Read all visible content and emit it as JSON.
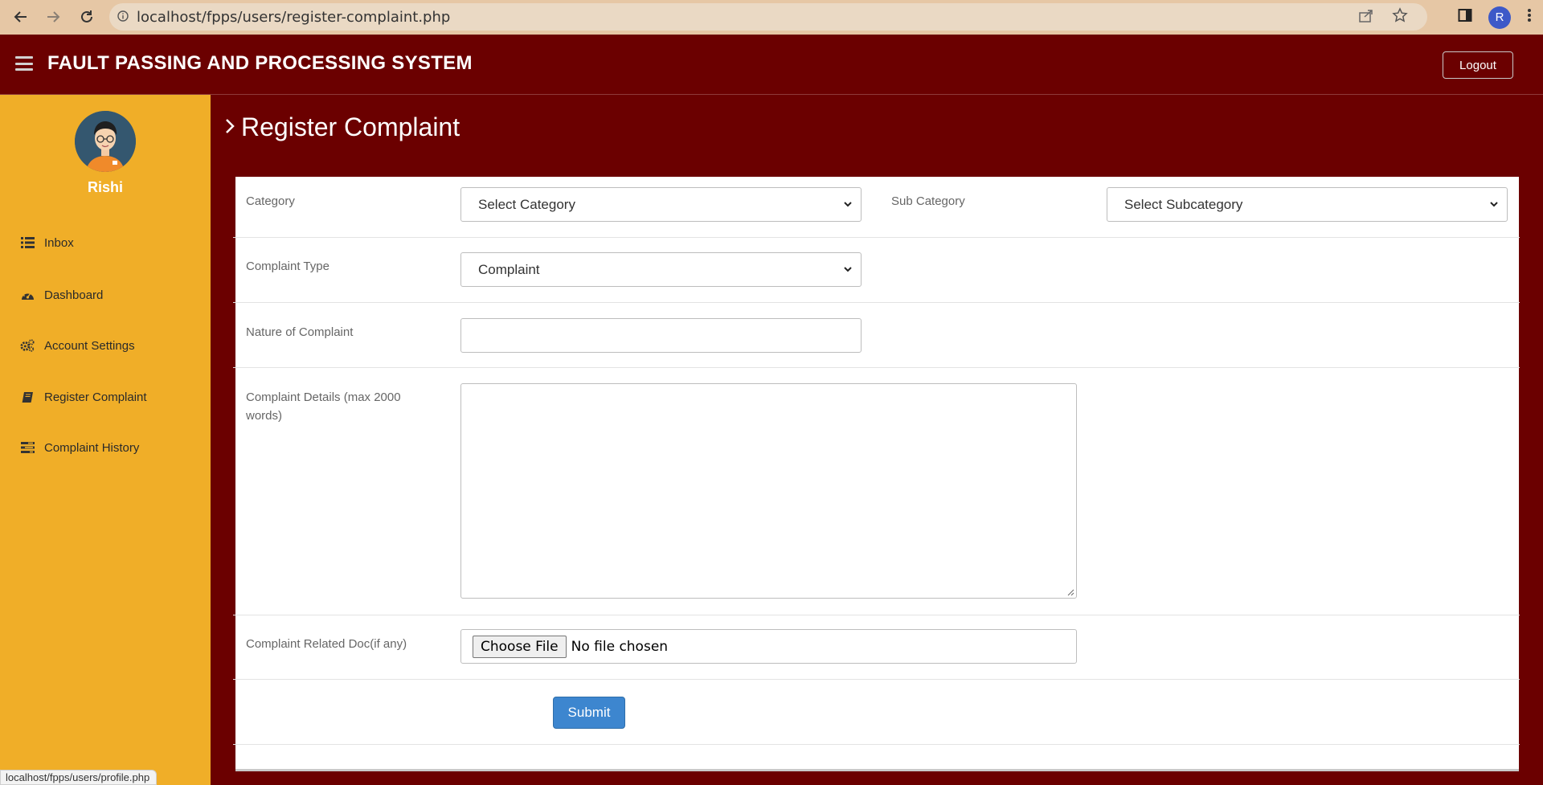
{
  "browser": {
    "url": "localhost/fpps/users/register-complaint.php",
    "profile_initial": "R",
    "status_url": "localhost/fpps/users/profile.php"
  },
  "header": {
    "title": "FAULT PASSING AND PROCESSING SYSTEM",
    "logout_label": "Logout"
  },
  "sidebar": {
    "user_name": "Rishi",
    "items": [
      {
        "label": "Inbox",
        "icon": "list-icon"
      },
      {
        "label": "Dashboard",
        "icon": "dashboard-icon"
      },
      {
        "label": "Account Settings",
        "icon": "gears-icon"
      },
      {
        "label": "Register Complaint",
        "icon": "book-icon"
      },
      {
        "label": "Complaint History",
        "icon": "tasks-icon"
      }
    ]
  },
  "page": {
    "title": "Register Complaint"
  },
  "form": {
    "category_label": "Category",
    "category_value": "Select Category",
    "subcategory_label": "Sub Category",
    "subcategory_value": "Select Subcategory",
    "complaint_type_label": "Complaint Type",
    "complaint_type_value": "Complaint",
    "nature_label": "Nature of Complaint",
    "nature_value": "",
    "details_label": "Complaint Details (max 2000 words)",
    "details_value": "",
    "doc_label": "Complaint Related Doc(if any)",
    "file_button": "Choose File",
    "file_status": "No file chosen",
    "submit_label": "Submit"
  },
  "colors": {
    "header_bg": "#6b0000",
    "sidebar_bg": "#f0ae28",
    "submit_bg": "#3d86cf",
    "browser_bar": "#e6c7a5"
  }
}
